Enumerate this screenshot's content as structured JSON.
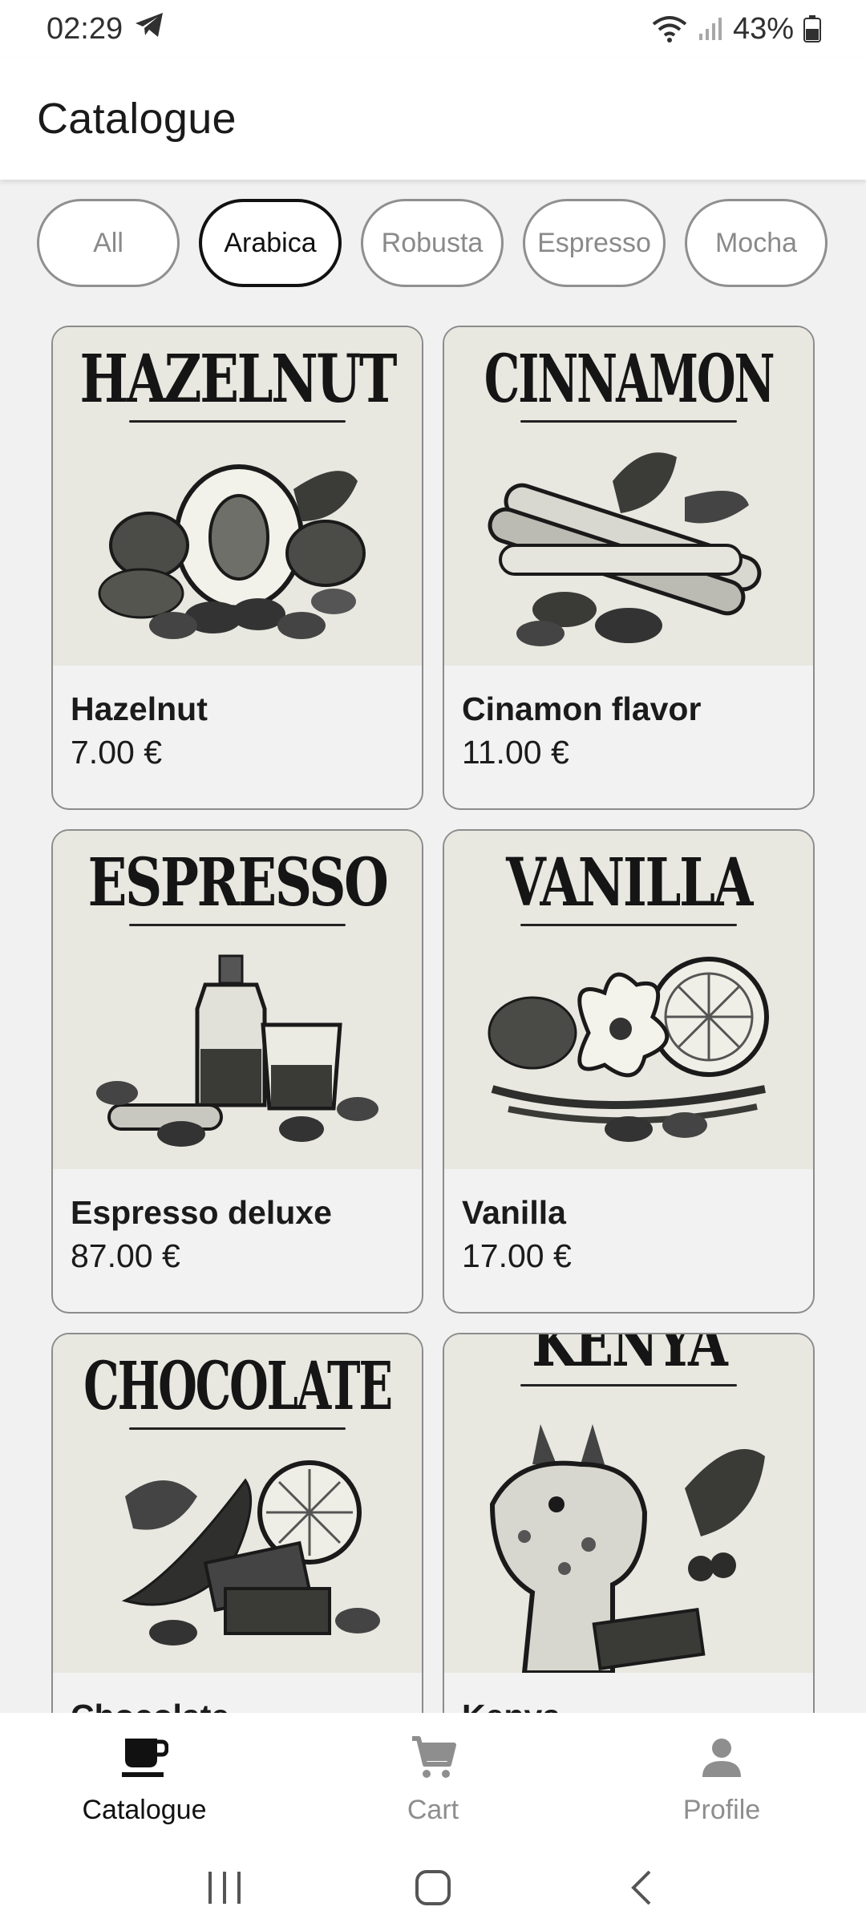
{
  "status_bar": {
    "time": "02:29",
    "battery": "43%",
    "icons": [
      "telegram-icon",
      "wifi-icon",
      "signal-icon",
      "battery-icon"
    ]
  },
  "app_bar": {
    "title": "Catalogue"
  },
  "filters": {
    "chips": [
      {
        "label": "All",
        "selected": false
      },
      {
        "label": "Arabica",
        "selected": true
      },
      {
        "label": "Robusta",
        "selected": false
      },
      {
        "label": "Espresso",
        "selected": false
      },
      {
        "label": "Mocha",
        "selected": false
      }
    ]
  },
  "products": [
    {
      "art_title": "HAZELNUT",
      "name": "Hazelnut",
      "price": "7.00 €",
      "icon": "hazelnut-illustration"
    },
    {
      "art_title": "CINNAMON",
      "name": "Cinamon flavor",
      "price": "11.00 €",
      "icon": "cinnamon-illustration"
    },
    {
      "art_title": "ESPRESSO",
      "name": "Espresso deluxe",
      "price": "87.00 €",
      "icon": "espresso-illustration"
    },
    {
      "art_title": "VANILLA",
      "name": "Vanilla",
      "price": "17.00 €",
      "icon": "vanilla-illustration"
    },
    {
      "art_title": "CHOCOLATE",
      "name": "Chocolate",
      "price": "",
      "icon": "chocolate-illustration"
    },
    {
      "art_title": "KENYA",
      "name": "Kenya",
      "price": "",
      "icon": "kenya-illustration"
    }
  ],
  "bottom_nav": {
    "items": [
      {
        "label": "Catalogue",
        "icon": "coffee-cup-icon",
        "active": true
      },
      {
        "label": "Cart",
        "icon": "cart-icon",
        "active": false
      },
      {
        "label": "Profile",
        "icon": "person-icon",
        "active": false
      }
    ]
  },
  "colors": {
    "background": "#f1f1f1",
    "surface": "#ffffff",
    "card": "#f2f2f2",
    "selected_border": "#111111",
    "inactive": "#8e8e8e"
  }
}
